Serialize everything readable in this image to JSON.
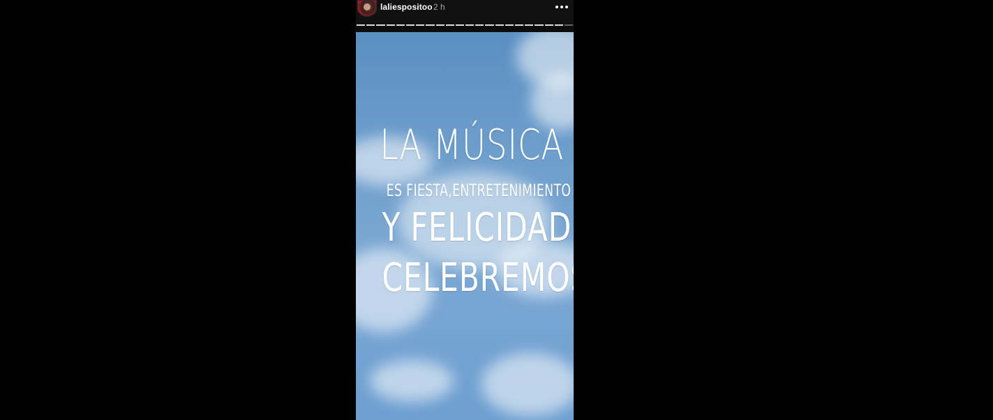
{
  "story": {
    "username": "laliespositoo",
    "time_ago": "2 h",
    "more_icon": "more-horizontal-icon",
    "progress": {
      "total_segments": 22,
      "completed_segments": 21
    }
  },
  "media": {
    "lines": [
      "LA MÚSICA",
      "ES FIESTA,ENTRETENIMIENTO",
      "Y FELICIDAD.",
      "CELEBREMOS!"
    ]
  },
  "colors": {
    "background": "#000000",
    "header": "#111111",
    "sky_top": "#5a8fc2",
    "sky_bottom": "#6e9fd0",
    "text": "#ffffff"
  }
}
